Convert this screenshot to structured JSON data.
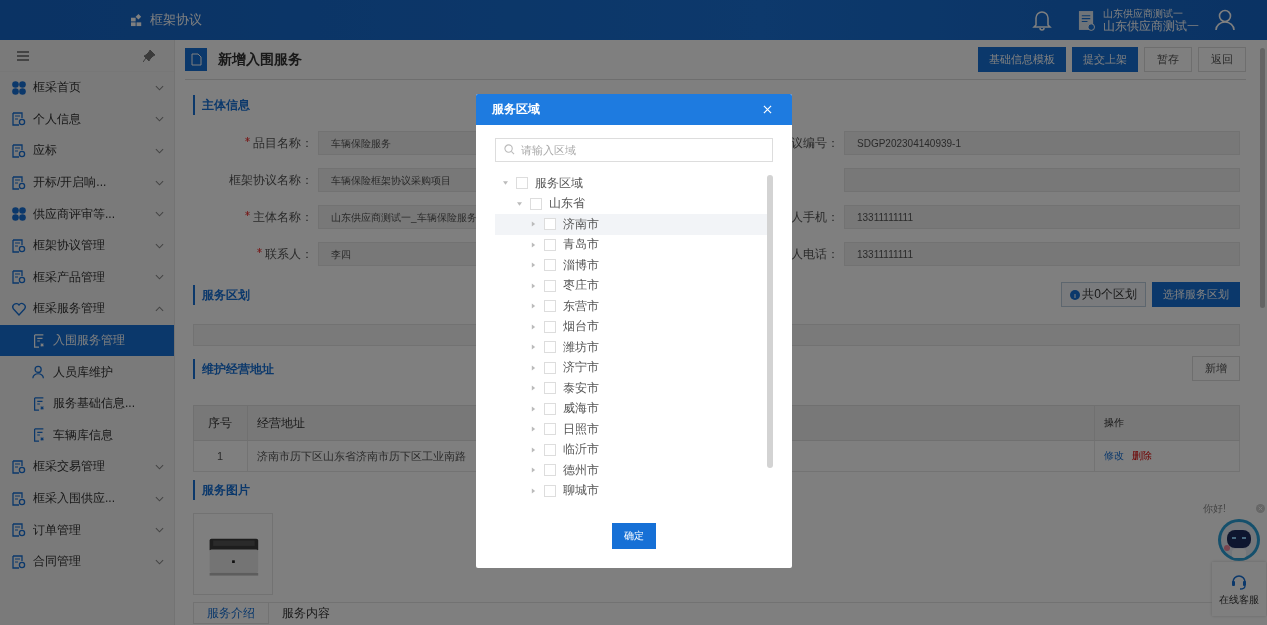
{
  "header": {
    "app_title": "框架协议",
    "user_org": "山东供应商测试一",
    "user_name": "山东供应商测试一"
  },
  "sidebar": {
    "items": [
      {
        "label": "框采首页",
        "expanded": false,
        "selected": false
      },
      {
        "label": "个人信息",
        "expanded": false,
        "selected": false
      },
      {
        "label": "应标",
        "expanded": false,
        "selected": false
      },
      {
        "label": "开标/开启响...",
        "expanded": false,
        "selected": false
      },
      {
        "label": "供应商评审等...",
        "expanded": false,
        "selected": false
      },
      {
        "label": "框架协议管理",
        "expanded": false,
        "selected": false
      },
      {
        "label": "框采产品管理",
        "expanded": false,
        "selected": false
      },
      {
        "label": "框采服务管理",
        "expanded": true,
        "selected": false,
        "children": [
          {
            "label": "入围服务管理",
            "selected": true
          },
          {
            "label": "人员库维护",
            "selected": false
          },
          {
            "label": "服务基础信息...",
            "selected": false
          },
          {
            "label": "车辆库信息",
            "selected": false
          }
        ]
      },
      {
        "label": "框采交易管理",
        "expanded": false,
        "selected": false
      },
      {
        "label": "框采入围供应...",
        "expanded": false,
        "selected": false
      },
      {
        "label": "订单管理",
        "expanded": false,
        "selected": false
      },
      {
        "label": "合同管理",
        "expanded": false,
        "selected": false
      }
    ]
  },
  "page": {
    "title": "新增入围服务",
    "actions": [
      {
        "label": "基础信息模板",
        "kind": "primary"
      },
      {
        "label": "提交上架",
        "kind": "primary"
      },
      {
        "label": "暂存",
        "kind": "default"
      },
      {
        "label": "返回",
        "kind": "default"
      }
    ]
  },
  "main_info": {
    "title": "主体信息",
    "rows": [
      {
        "left": {
          "label": "品目名称：",
          "required": true,
          "value": "车辆保险服务"
        },
        "right": {
          "label": "议编号：",
          "value": "SDGP202304140939-1"
        }
      },
      {
        "left": {
          "label": "框架协议名称：",
          "required": false,
          "value": "车辆保险框架协议采购项目"
        },
        "right": {}
      },
      {
        "left": {
          "label": "主体名称：",
          "required": true,
          "value": "山东供应商测试一_车辆保险服务"
        },
        "right": {
          "label": "人手机：",
          "value": "13311111111"
        }
      },
      {
        "left": {
          "label": "联系人：",
          "required": true,
          "value": "李四"
        },
        "right": {
          "label": "人电话：",
          "value": "13311111111"
        }
      }
    ]
  },
  "service_area": {
    "title": "服务区划",
    "count_label": "共0个区划",
    "select_button": "选择服务区划"
  },
  "address": {
    "title": "维护经营地址",
    "add_button": "新增",
    "table": {
      "columns": [
        "序号",
        "经营地址",
        "操作"
      ],
      "rows": [
        {
          "index": "1",
          "address": "济南市历下区山东省济南市历下区工业南路",
          "actions": [
            {
              "label": "修改",
              "kind": "edit"
            },
            {
              "label": "删除",
              "kind": "delete"
            }
          ]
        }
      ]
    }
  },
  "images": {
    "title": "服务图片"
  },
  "tabs": [
    {
      "label": "服务介绍",
      "selected": true
    },
    {
      "label": "服务内容",
      "selected": false
    }
  ],
  "chat_widget": {
    "greeting": "你好!",
    "label": "在线客服"
  },
  "modal": {
    "title": "服务区域",
    "search_placeholder": "请输入区域",
    "confirm_button": "确定",
    "tree": [
      {
        "label": "服务区域",
        "checked": false,
        "expanded": true,
        "selected": false,
        "children": [
          {
            "label": "山东省",
            "checked": false,
            "expanded": true,
            "selected": false,
            "children": [
              {
                "label": "济南市",
                "checked": false,
                "expanded": false,
                "selected": true
              },
              {
                "label": "青岛市",
                "checked": false,
                "expanded": false,
                "selected": false
              },
              {
                "label": "淄博市",
                "checked": false,
                "expanded": false,
                "selected": false
              },
              {
                "label": "枣庄市",
                "checked": false,
                "expanded": false,
                "selected": false
              },
              {
                "label": "东营市",
                "checked": false,
                "expanded": false,
                "selected": false
              },
              {
                "label": "烟台市",
                "checked": false,
                "expanded": false,
                "selected": false
              },
              {
                "label": "潍坊市",
                "checked": false,
                "expanded": false,
                "selected": false
              },
              {
                "label": "济宁市",
                "checked": false,
                "expanded": false,
                "selected": false
              },
              {
                "label": "泰安市",
                "checked": false,
                "expanded": false,
                "selected": false
              },
              {
                "label": "威海市",
                "checked": false,
                "expanded": false,
                "selected": false
              },
              {
                "label": "日照市",
                "checked": false,
                "expanded": false,
                "selected": false
              },
              {
                "label": "临沂市",
                "checked": false,
                "expanded": false,
                "selected": false
              },
              {
                "label": "德州市",
                "checked": false,
                "expanded": false,
                "selected": false
              },
              {
                "label": "聊城市",
                "checked": false,
                "expanded": false,
                "selected": false
              }
            ]
          }
        ]
      }
    ]
  }
}
